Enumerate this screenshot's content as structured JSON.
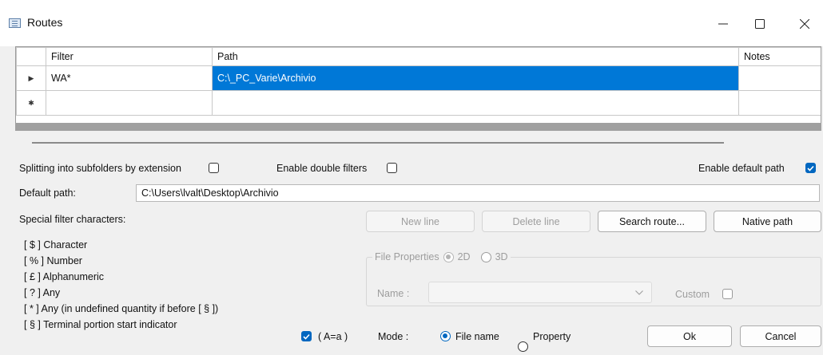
{
  "window": {
    "title": "Routes",
    "icon": "list-window-icon",
    "controls": [
      "minimize-icon",
      "maximize-icon",
      "close-icon"
    ]
  },
  "grid": {
    "columns": [
      "Filter",
      "Path",
      "Notes"
    ],
    "rows": [
      {
        "marker": "▶",
        "filter": "WA*",
        "path": "C:\\_PC_Varie\\Archivio",
        "notes": ""
      },
      {
        "marker": "✱",
        "filter": "",
        "path": "",
        "notes": ""
      }
    ]
  },
  "options": {
    "split_label": "Splitting into subfolders by extension",
    "split_checked": false,
    "double_label": "Enable double filters",
    "double_checked": false,
    "default_path_enable_label": "Enable default path",
    "default_path_enabled": true
  },
  "default_path": {
    "label": "Default path:",
    "value": "C:\\Users\\lvalt\\Desktop\\Archivio"
  },
  "special": {
    "heading": "Special filter characters:",
    "items": [
      "[ $ ]  Character",
      "[ % ]  Number",
      "[ £ ]  Alphanumeric",
      "[ ? ]  Any",
      "[ * ]  Any (in undefined quantity if before [ § ])",
      "[ § ]  Terminal portion start indicator"
    ]
  },
  "buttons": {
    "new_line": "New line",
    "delete_line": "Delete line",
    "search_route": "Search route...",
    "native_path": "Native path",
    "ok": "Ok",
    "cancel": "Cancel"
  },
  "file_properties": {
    "title": "File Properties",
    "opt_2d": "2D",
    "opt_3d": "3D",
    "selected": "2D",
    "name_label": "Name :",
    "name_value": "",
    "custom_label": "Custom",
    "custom_checked": false
  },
  "case": {
    "label": "( A=a )",
    "checked": true
  },
  "mode": {
    "label": "Mode :",
    "file_name": "File name",
    "property": "Property",
    "selected": "File name"
  },
  "colors": {
    "accent": "#0067c0",
    "selection": "#0078d7"
  }
}
